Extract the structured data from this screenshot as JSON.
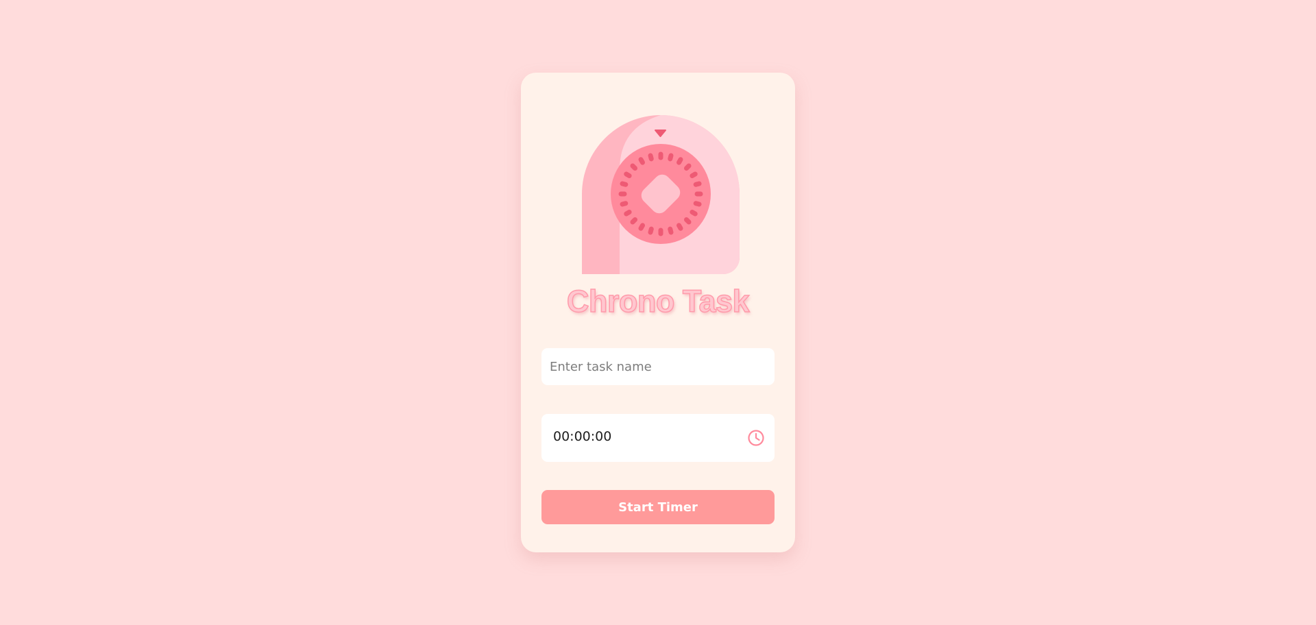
{
  "app": {
    "title": "Chrono Task"
  },
  "form": {
    "task_placeholder": "Enter task name",
    "task_value": "",
    "time_value": "00:00:00",
    "start_label": "Start Timer"
  },
  "icons": {
    "logo": "kitchen-timer-icon",
    "time_picker": "clock-icon"
  },
  "colors": {
    "page_background": "#ffdcdc",
    "card_background": "#fff2ea",
    "accent": "#ff9a9a",
    "dial": "#ff8a9c",
    "tick_marks": "#ee5a74"
  }
}
